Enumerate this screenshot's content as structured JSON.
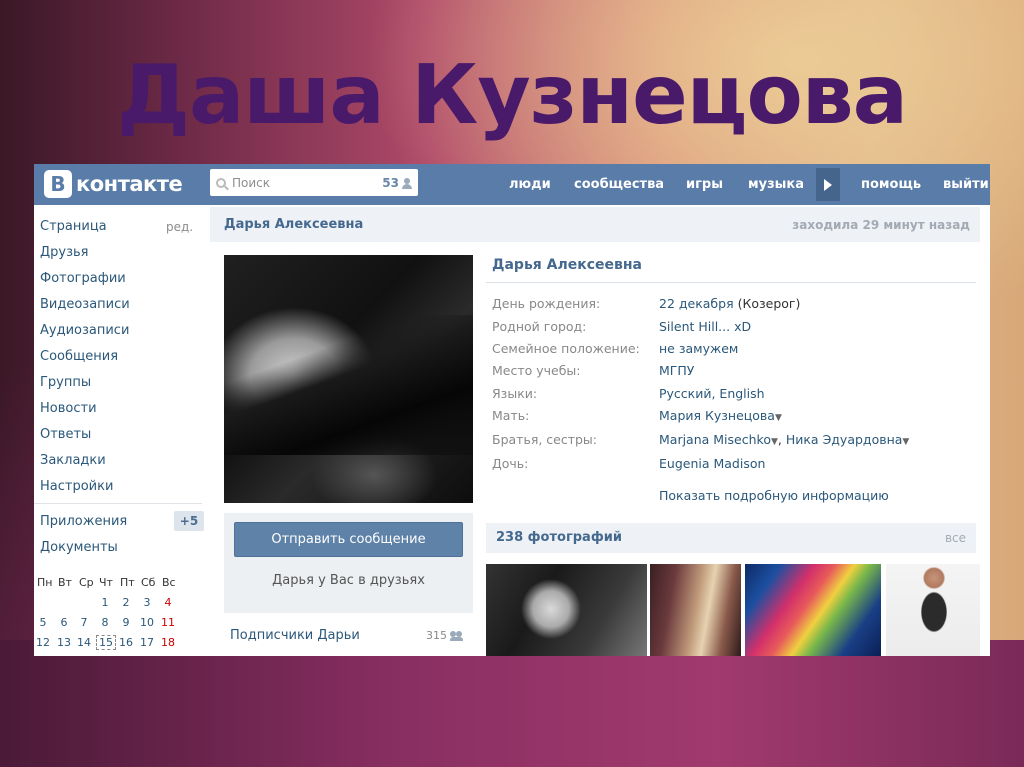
{
  "slide": {
    "title": "Даша Кузнецова"
  },
  "topbar": {
    "logo_letter": "В",
    "logo_text": "контакте",
    "search_placeholder": "Поиск",
    "search_count": "53",
    "nav": [
      "люди",
      "сообщества",
      "игры",
      "музыка",
      "помощь",
      "выйти"
    ]
  },
  "sidebar": {
    "items": [
      "Страница",
      "Друзья",
      "Фотографии",
      "Видеозаписи",
      "Аудиозаписи",
      "Сообщения",
      "Группы",
      "Новости",
      "Ответы",
      "Закладки",
      "Настройки"
    ],
    "edit_label": "ред.",
    "apps_label": "Приложения",
    "apps_badge": "+5",
    "docs_label": "Документы",
    "calendar": {
      "weekdays": [
        "Пн",
        "Вт",
        "Ср",
        "Чт",
        "Пт",
        "Сб",
        "Вс"
      ],
      "week1": [
        "1",
        "2",
        "3",
        "4"
      ],
      "week2": [
        "5",
        "6",
        "7",
        "8",
        "9",
        "10",
        "11"
      ],
      "week3": [
        "12",
        "13",
        "14",
        "15",
        "16",
        "17",
        "18"
      ],
      "today": "15"
    }
  },
  "profile": {
    "header_name": "Дарья Алексеевна",
    "last_seen": "заходила 29 минут назад",
    "name": "Дарья Алексеевна",
    "send_message": "Отправить сообщение",
    "friend_status": "Дарья у Вас в друзьях",
    "subscribers_label": "Подписчики Дарьи",
    "subscribers_count": "315",
    "info": {
      "birthday_label": "День рождения:",
      "birthday_value": "22 декабря",
      "zodiac": "(Козерог)",
      "hometown_label": "Родной город:",
      "hometown_value": "Silent Hill... xD",
      "marital_label": "Семейное положение:",
      "marital_value": "не замужем",
      "study_label": "Место учебы:",
      "study_value": "МГПУ",
      "languages_label": "Языки:",
      "languages_value": "Русский, English",
      "mother_label": "Мать:",
      "mother_value": "Мария Кузнецова",
      "siblings_label": "Братья, сестры:",
      "sibling1": "Marjana Misechko",
      "sibling2": "Ника Эдуардовна",
      "daughter_label": "Дочь:",
      "daughter_value": "Eugenia Madison"
    },
    "show_more": "Показать подробную информацию",
    "photos_title": "238 фотографий",
    "photos_all": "все"
  },
  "colors": {
    "vk_blue": "#5a7ca8",
    "link": "#2b587a",
    "title": "#4a1a6a"
  }
}
